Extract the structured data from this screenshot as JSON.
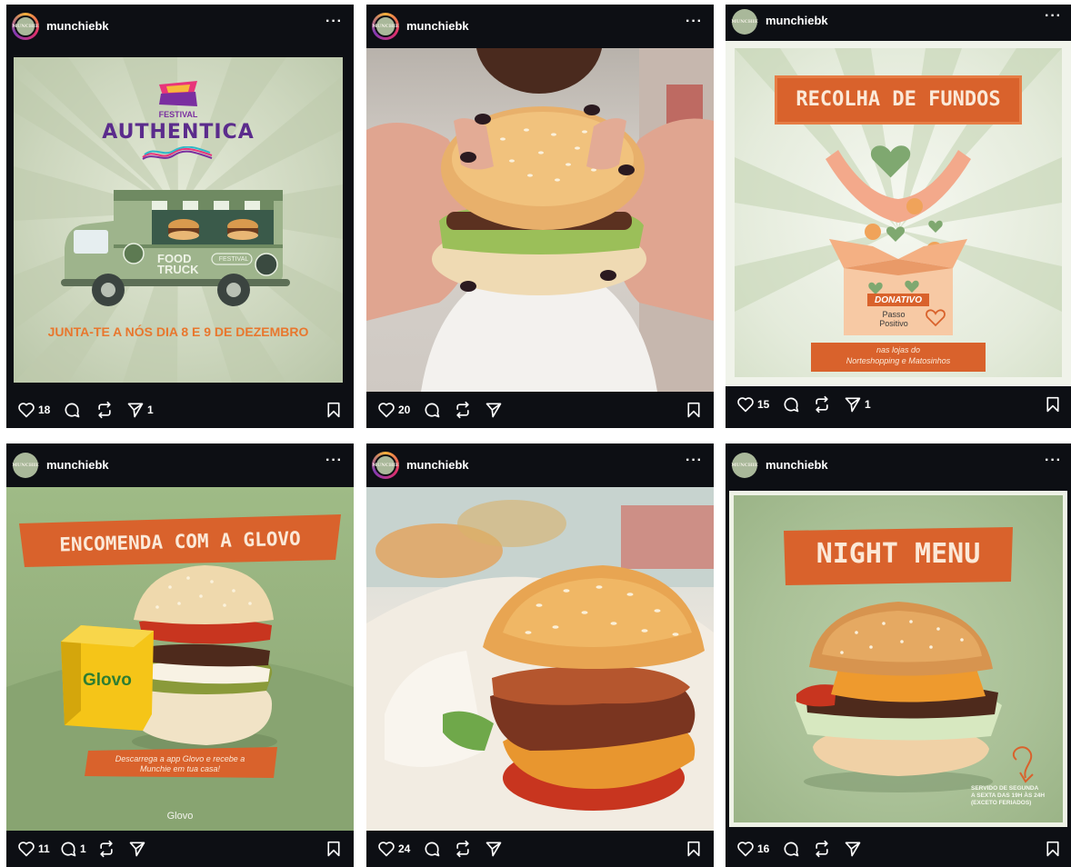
{
  "username": "munchiebk",
  "avatar_text": "MUNCHIE",
  "more_label": "···",
  "posts": [
    {
      "likes": "18",
      "comments": "",
      "shares": "1",
      "image": {
        "festival_word": "FESTIVAL",
        "festival_name": "AUTHENTICA",
        "truck_text_1": "FOOD",
        "truck_text_2": "TRUCK",
        "truck_badge": "FESTIVAL",
        "caption": "Junta-te a nós dia 8 e 9 de dezembro"
      }
    },
    {
      "likes": "20",
      "comments": "",
      "shares": ""
    },
    {
      "likes": "15",
      "comments": "",
      "shares": "1",
      "image": {
        "banner": "RECOLHA DE FUNDOS",
        "box_label": "DONATIVO",
        "brand_1": "Passo",
        "brand_2": "Positivo",
        "footer_1": "nas lojas do",
        "footer_2": "Norteshopping e Matosinhos"
      }
    },
    {
      "likes": "11",
      "comments": "1",
      "shares": "",
      "image": {
        "banner": "ENCOMENDA COM A GLOVO",
        "bag_brand": "Glovo",
        "caption_1": "Descarrega a app Glovo e recebe a",
        "caption_2": "Munchie em tua casa!",
        "footer_logo": "Glovo"
      }
    },
    {
      "likes": "24",
      "comments": "",
      "shares": ""
    },
    {
      "likes": "16",
      "comments": "",
      "shares": "",
      "image": {
        "banner": "NIGHT MENU",
        "note_1": "SERVIDO DE SEGUNDA",
        "note_2": "A SEXTA DAS 19H ÀS 24H",
        "note_3": "(EXCETO FERIADOS)"
      }
    }
  ],
  "colors": {
    "card_bg": "#0d0f14",
    "sage": "#c8d4b8",
    "orange": "#e06a30",
    "glovo_yellow": "#f5c518"
  }
}
